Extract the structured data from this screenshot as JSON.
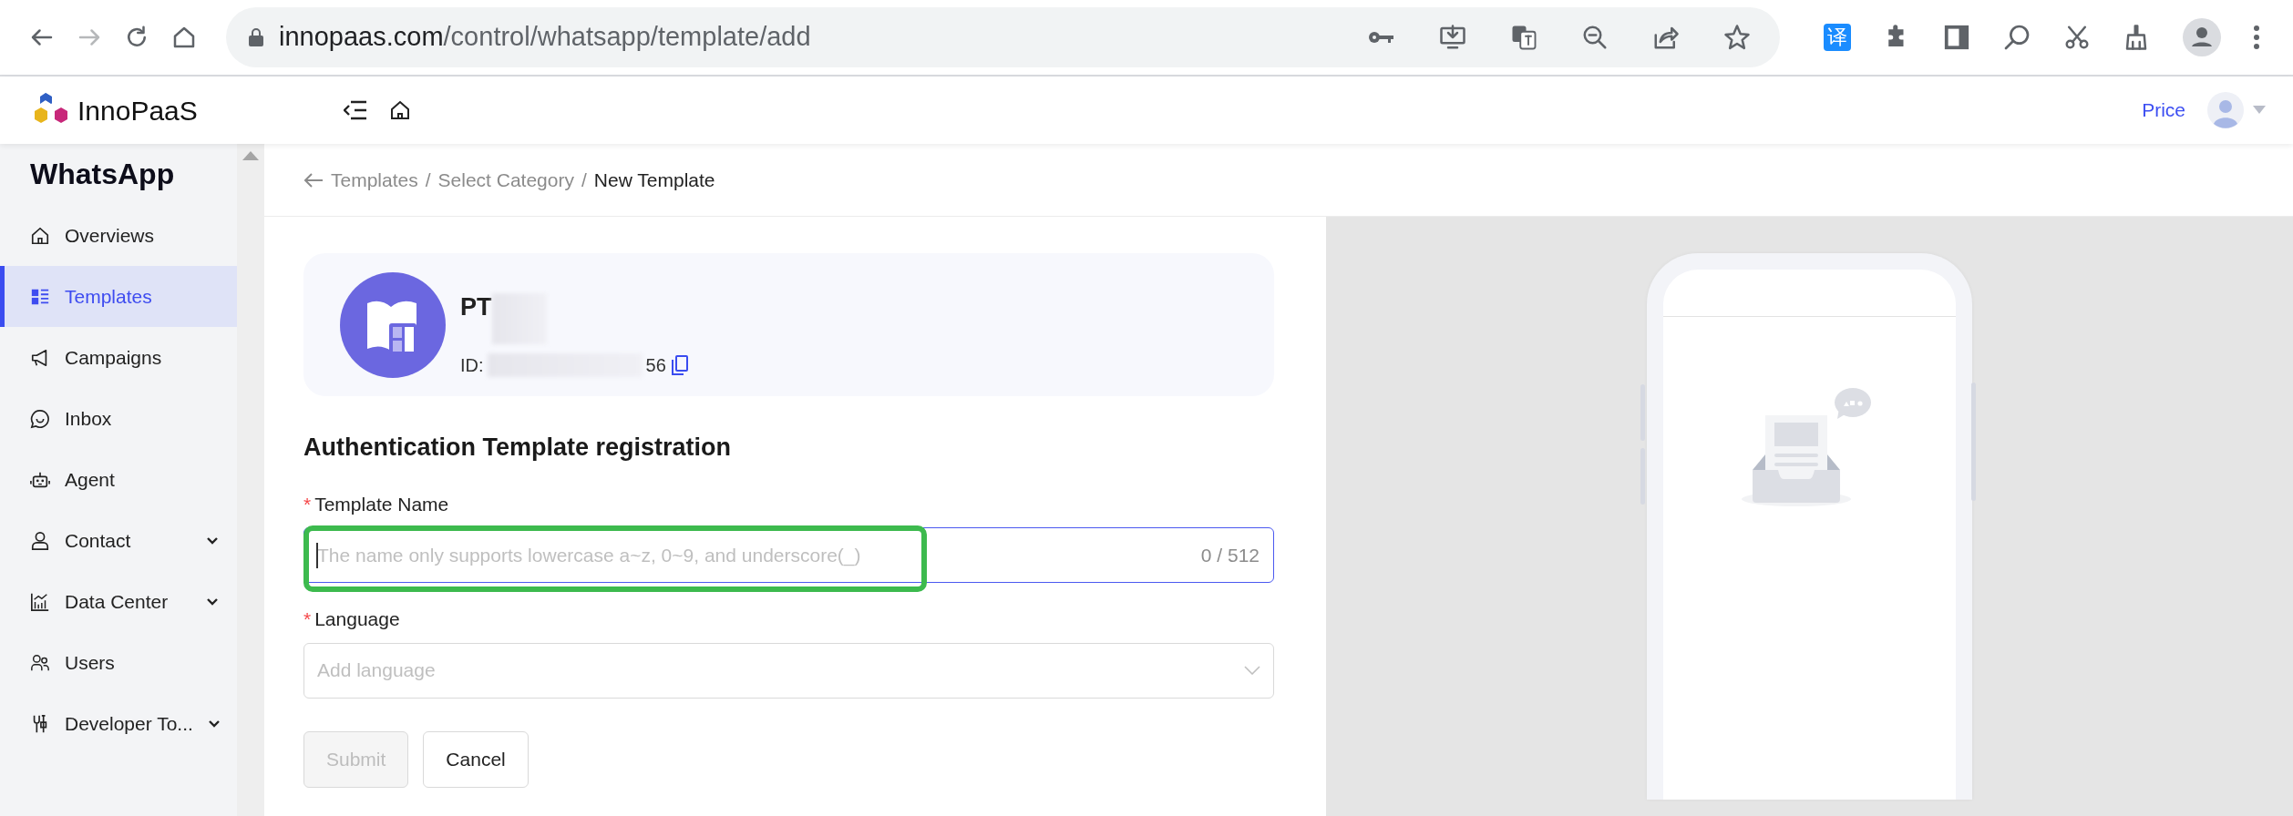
{
  "browser": {
    "url_host": "innopaas.com",
    "url_path": "/control/whatsapp/template/add",
    "extension_badge": "译"
  },
  "header": {
    "brand": "InnoPaaS",
    "price_link": "Price"
  },
  "sidebar": {
    "title": "WhatsApp",
    "items": [
      {
        "label": "Overviews",
        "kind": "home",
        "selected": false,
        "expandable": false
      },
      {
        "label": "Templates",
        "kind": "list",
        "selected": true,
        "expandable": false
      },
      {
        "label": "Campaigns",
        "kind": "megaphone",
        "selected": false,
        "expandable": false
      },
      {
        "label": "Inbox",
        "kind": "chat",
        "selected": false,
        "expandable": false
      },
      {
        "label": "Agent",
        "kind": "robot",
        "selected": false,
        "expandable": false
      },
      {
        "label": "Contact",
        "kind": "person",
        "selected": false,
        "expandable": true
      },
      {
        "label": "Data Center",
        "kind": "chart",
        "selected": false,
        "expandable": true
      },
      {
        "label": "Users",
        "kind": "users",
        "selected": false,
        "expandable": false
      },
      {
        "label": "Developer To...",
        "kind": "tools",
        "selected": false,
        "expandable": true
      }
    ]
  },
  "breadcrumb": [
    {
      "label": "Templates",
      "current": false
    },
    {
      "separator": "/",
      "label": "Select Category",
      "current": false
    },
    {
      "separator": "/",
      "label": "New Template",
      "current": true
    }
  ],
  "account": {
    "name": "PT",
    "id_label": "ID:",
    "id_suffix": "56"
  },
  "form": {
    "heading": "Authentication Template registration",
    "fields": [
      {
        "kind": "text",
        "required_mark": "*",
        "label": "Template Name",
        "placeholder": "The name only supports lowercase a~z, 0~9, and underscore(_)",
        "counter": "0 / 512",
        "focused": true,
        "highlighted": true
      },
      {
        "kind": "select",
        "required_mark": "*",
        "label": "Language",
        "placeholder": "Add language"
      }
    ]
  },
  "buttons": [
    {
      "label": "Submit",
      "disabled": true
    },
    {
      "label": "Cancel",
      "disabled": false
    }
  ]
}
